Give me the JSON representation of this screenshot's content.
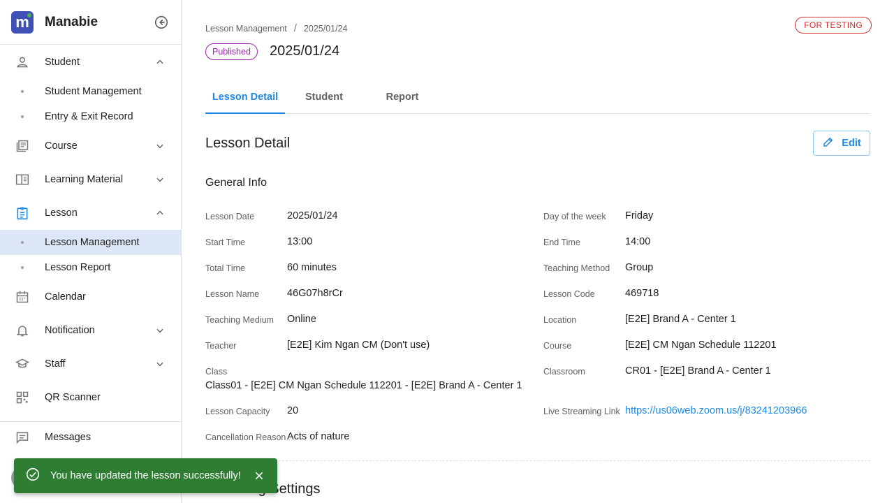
{
  "app": {
    "name": "Manabie"
  },
  "sidebar": {
    "items": [
      {
        "label": "Student",
        "icon": "person-icon",
        "expanded": true
      },
      {
        "label": "Student Management"
      },
      {
        "label": "Entry & Exit Record"
      },
      {
        "label": "Course",
        "icon": "course-icon",
        "expanded": false
      },
      {
        "label": "Learning Material",
        "icon": "book-icon",
        "expanded": false
      },
      {
        "label": "Lesson",
        "icon": "clipboard-icon",
        "expanded": true
      },
      {
        "label": "Lesson Management",
        "active": true
      },
      {
        "label": "Lesson Report"
      },
      {
        "label": "Calendar",
        "icon": "calendar-icon"
      },
      {
        "label": "Notification",
        "icon": "bell-icon",
        "expanded": false
      },
      {
        "label": "Staff",
        "icon": "school-icon",
        "expanded": false
      },
      {
        "label": "QR Scanner",
        "icon": "qr-code-icon"
      },
      {
        "label": "Messages",
        "icon": "message-icon"
      }
    ]
  },
  "toast": {
    "message": "You have updated the lesson successfully!",
    "color": "#2e7d32"
  },
  "header": {
    "breadcrumb": [
      "Lesson Management",
      "2025/01/24"
    ],
    "environment_badge": "FOR TESTING",
    "status": "Published",
    "title": "2025/01/24"
  },
  "tabs": [
    "Lesson Detail",
    "Student",
    "Report"
  ],
  "detail": {
    "title": "Lesson Detail",
    "edit_label": "Edit",
    "general_info_title": "General Info",
    "left": [
      {
        "label": "Lesson Date",
        "value": "2025/01/24"
      },
      {
        "label": "Start Time",
        "value": "13:00"
      },
      {
        "label": "Total Time",
        "value": "60 minutes"
      },
      {
        "label": "Lesson Name",
        "value": "46G07h8rCr"
      },
      {
        "label": "Teaching Medium",
        "value": "Online"
      },
      {
        "label": "Teacher",
        "value": "[E2E] Kim Ngan CM (Don't use)"
      },
      {
        "label": "Class",
        "value": "Class01 - [E2E] CM Ngan Schedule 112201 - [E2E] Brand A - Center 1"
      },
      {
        "label": "Lesson Capacity",
        "value": "20"
      },
      {
        "label": "Cancellation Reason",
        "value": "Acts of nature"
      }
    ],
    "right": [
      {
        "label": "Day of the week",
        "value": "Friday"
      },
      {
        "label": "End Time",
        "value": "14:00"
      },
      {
        "label": "Teaching Method",
        "value": "Group"
      },
      {
        "label": "Lesson Code",
        "value": "469718"
      },
      {
        "label": "Location",
        "value": "[E2E] Brand A - Center 1"
      },
      {
        "label": "Course",
        "value": "[E2E] CM Ngan Schedule 112201"
      },
      {
        "label": "Classroom",
        "value": "CR01 - [E2E] Brand A - Center 1"
      },
      {
        "label": "Live Streaming Link",
        "value": "https://us06web.zoom.us/j/83241203966"
      }
    ],
    "recurring_title": "Recurring Settings"
  },
  "colors": {
    "accent": "#1e88e5",
    "published": "#9c27b0",
    "testing": "#d32f2f",
    "active_nav": "#dde7f7"
  }
}
